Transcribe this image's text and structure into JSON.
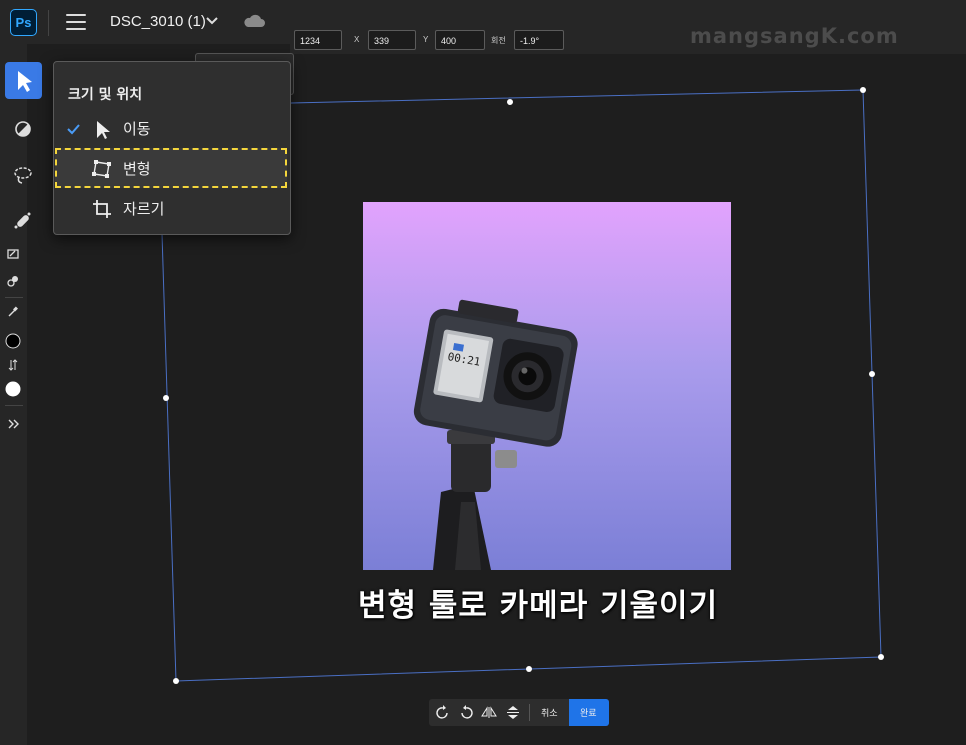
{
  "app": {
    "logo": "Ps",
    "document_title": "DSC_3010 (1)"
  },
  "options": {
    "width": "1234",
    "x_label": "X",
    "x_value": "339",
    "y_label": "Y",
    "y_value": "400",
    "rotate_label": "회전",
    "rotate_value": "-1.9°"
  },
  "watermark": "mangsangK.com",
  "menu": {
    "heading": "크기 및 위치",
    "items": [
      {
        "label": "이동",
        "icon": "arrow-cursor-icon",
        "checked": true
      },
      {
        "label": "변형",
        "icon": "transform-icon",
        "checked": false,
        "highlighted": true
      },
      {
        "label": "자르기",
        "icon": "crop-icon",
        "checked": false
      }
    ]
  },
  "caption": "변형 툴로 카메라 기울이기",
  "bottom_bar": {
    "cancel_label": "취소",
    "done_label": "완료"
  },
  "colors": {
    "accent": "#3a7ae6",
    "done": "#1f74e8",
    "highlight": "#f4d63c",
    "bounding_box": "#4a6fc4"
  }
}
